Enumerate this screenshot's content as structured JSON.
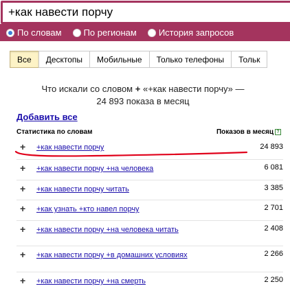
{
  "search": {
    "value": "+как навести порчу"
  },
  "radio_options": [
    {
      "label": "По словам",
      "checked": true
    },
    {
      "label": "По регионам",
      "checked": false
    },
    {
      "label": "История запросов",
      "checked": false
    }
  ],
  "tabs": [
    "Все",
    "Десктопы",
    "Мобильные",
    "Только телефоны",
    "Тольк"
  ],
  "summary": {
    "prefix": "Что искали со словом",
    "plus": "+",
    "text": "«+как навести порчу» — 24 893 показа в месяц"
  },
  "add_all_label": "Добавить все",
  "table": {
    "col_left": "Статистика по словам",
    "col_right": "Показов в месяц",
    "help_glyph": "?",
    "rows": [
      {
        "phrase": "+как навести порчу",
        "count": "24 893"
      },
      {
        "phrase": "+как навести порчу +на человека",
        "count": "6 081"
      },
      {
        "phrase": "+как навести порчу читать",
        "count": "3 385"
      },
      {
        "phrase": "+как узнать +кто навел порчу",
        "count": "2 701"
      },
      {
        "phrase": "+как навести порчу +на человека читать",
        "count": "2 408"
      },
      {
        "phrase": "+как навести порчу +в домашних условиях",
        "count": "2 266"
      },
      {
        "phrase": "+как навести порчу +на смерть",
        "count": "2 250"
      }
    ]
  },
  "colors": {
    "accent": "#a4345e",
    "link": "#1a0dab",
    "annotation": "#e0001a"
  }
}
